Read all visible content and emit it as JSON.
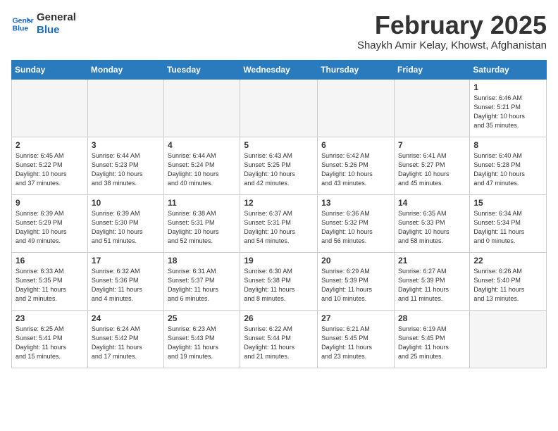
{
  "logo": {
    "line1": "General",
    "line2": "Blue"
  },
  "header": {
    "month": "February 2025",
    "location": "Shaykh Amir Kelay, Khowst, Afghanistan"
  },
  "weekdays": [
    "Sunday",
    "Monday",
    "Tuesday",
    "Wednesday",
    "Thursday",
    "Friday",
    "Saturday"
  ],
  "weeks": [
    [
      {
        "day": "",
        "info": ""
      },
      {
        "day": "",
        "info": ""
      },
      {
        "day": "",
        "info": ""
      },
      {
        "day": "",
        "info": ""
      },
      {
        "day": "",
        "info": ""
      },
      {
        "day": "",
        "info": ""
      },
      {
        "day": "1",
        "info": "Sunrise: 6:46 AM\nSunset: 5:21 PM\nDaylight: 10 hours\nand 35 minutes."
      }
    ],
    [
      {
        "day": "2",
        "info": "Sunrise: 6:45 AM\nSunset: 5:22 PM\nDaylight: 10 hours\nand 37 minutes."
      },
      {
        "day": "3",
        "info": "Sunrise: 6:44 AM\nSunset: 5:23 PM\nDaylight: 10 hours\nand 38 minutes."
      },
      {
        "day": "4",
        "info": "Sunrise: 6:44 AM\nSunset: 5:24 PM\nDaylight: 10 hours\nand 40 minutes."
      },
      {
        "day": "5",
        "info": "Sunrise: 6:43 AM\nSunset: 5:25 PM\nDaylight: 10 hours\nand 42 minutes."
      },
      {
        "day": "6",
        "info": "Sunrise: 6:42 AM\nSunset: 5:26 PM\nDaylight: 10 hours\nand 43 minutes."
      },
      {
        "day": "7",
        "info": "Sunrise: 6:41 AM\nSunset: 5:27 PM\nDaylight: 10 hours\nand 45 minutes."
      },
      {
        "day": "8",
        "info": "Sunrise: 6:40 AM\nSunset: 5:28 PM\nDaylight: 10 hours\nand 47 minutes."
      }
    ],
    [
      {
        "day": "9",
        "info": "Sunrise: 6:39 AM\nSunset: 5:29 PM\nDaylight: 10 hours\nand 49 minutes."
      },
      {
        "day": "10",
        "info": "Sunrise: 6:39 AM\nSunset: 5:30 PM\nDaylight: 10 hours\nand 51 minutes."
      },
      {
        "day": "11",
        "info": "Sunrise: 6:38 AM\nSunset: 5:31 PM\nDaylight: 10 hours\nand 52 minutes."
      },
      {
        "day": "12",
        "info": "Sunrise: 6:37 AM\nSunset: 5:31 PM\nDaylight: 10 hours\nand 54 minutes."
      },
      {
        "day": "13",
        "info": "Sunrise: 6:36 AM\nSunset: 5:32 PM\nDaylight: 10 hours\nand 56 minutes."
      },
      {
        "day": "14",
        "info": "Sunrise: 6:35 AM\nSunset: 5:33 PM\nDaylight: 10 hours\nand 58 minutes."
      },
      {
        "day": "15",
        "info": "Sunrise: 6:34 AM\nSunset: 5:34 PM\nDaylight: 11 hours\nand 0 minutes."
      }
    ],
    [
      {
        "day": "16",
        "info": "Sunrise: 6:33 AM\nSunset: 5:35 PM\nDaylight: 11 hours\nand 2 minutes."
      },
      {
        "day": "17",
        "info": "Sunrise: 6:32 AM\nSunset: 5:36 PM\nDaylight: 11 hours\nand 4 minutes."
      },
      {
        "day": "18",
        "info": "Sunrise: 6:31 AM\nSunset: 5:37 PM\nDaylight: 11 hours\nand 6 minutes."
      },
      {
        "day": "19",
        "info": "Sunrise: 6:30 AM\nSunset: 5:38 PM\nDaylight: 11 hours\nand 8 minutes."
      },
      {
        "day": "20",
        "info": "Sunrise: 6:29 AM\nSunset: 5:39 PM\nDaylight: 11 hours\nand 10 minutes."
      },
      {
        "day": "21",
        "info": "Sunrise: 6:27 AM\nSunset: 5:39 PM\nDaylight: 11 hours\nand 11 minutes."
      },
      {
        "day": "22",
        "info": "Sunrise: 6:26 AM\nSunset: 5:40 PM\nDaylight: 11 hours\nand 13 minutes."
      }
    ],
    [
      {
        "day": "23",
        "info": "Sunrise: 6:25 AM\nSunset: 5:41 PM\nDaylight: 11 hours\nand 15 minutes."
      },
      {
        "day": "24",
        "info": "Sunrise: 6:24 AM\nSunset: 5:42 PM\nDaylight: 11 hours\nand 17 minutes."
      },
      {
        "day": "25",
        "info": "Sunrise: 6:23 AM\nSunset: 5:43 PM\nDaylight: 11 hours\nand 19 minutes."
      },
      {
        "day": "26",
        "info": "Sunrise: 6:22 AM\nSunset: 5:44 PM\nDaylight: 11 hours\nand 21 minutes."
      },
      {
        "day": "27",
        "info": "Sunrise: 6:21 AM\nSunset: 5:45 PM\nDaylight: 11 hours\nand 23 minutes."
      },
      {
        "day": "28",
        "info": "Sunrise: 6:19 AM\nSunset: 5:45 PM\nDaylight: 11 hours\nand 25 minutes."
      },
      {
        "day": "",
        "info": ""
      }
    ]
  ]
}
